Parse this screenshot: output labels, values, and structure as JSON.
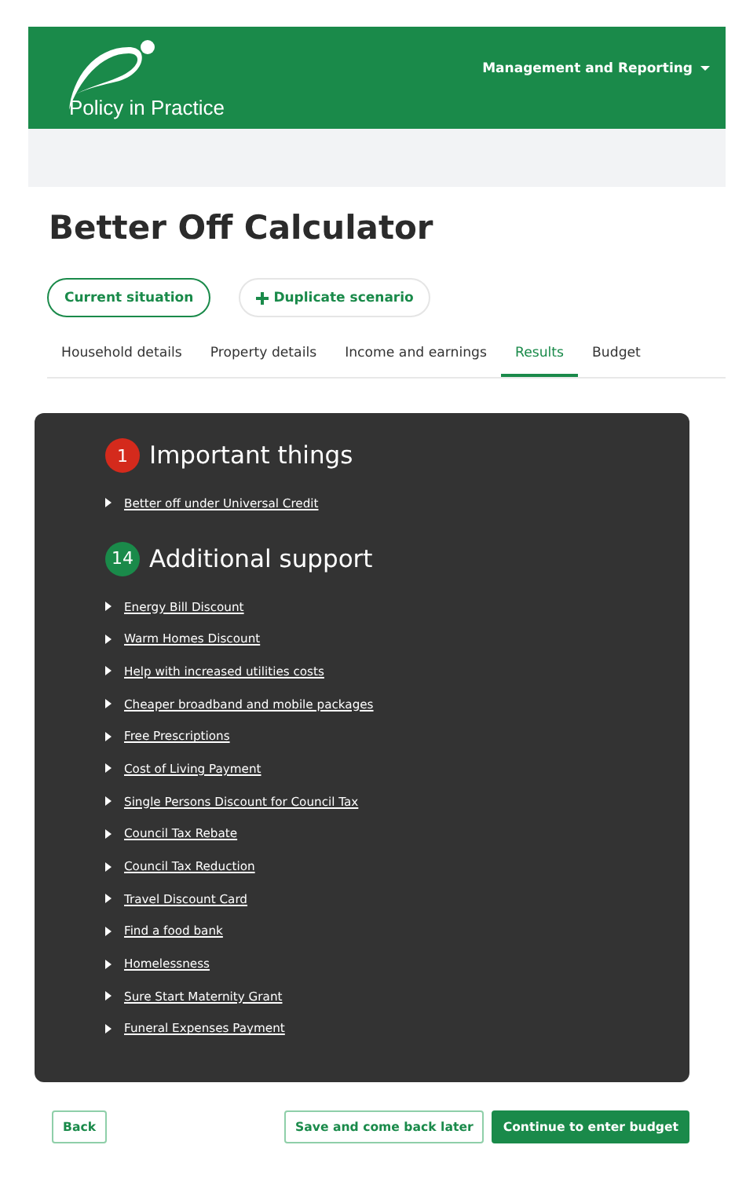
{
  "header": {
    "logo": "Policy in Practice",
    "menu": "Management and Reporting"
  },
  "title": "Better Off Calculator",
  "scenario_buttons": [
    {
      "label": "Current situation",
      "kind": "scenario"
    },
    {
      "label": "Duplicate scenario",
      "kind": "add"
    }
  ],
  "tabs": [
    {
      "label": "Household details",
      "selected": false
    },
    {
      "label": "Property details",
      "selected": false
    },
    {
      "label": "Income and earnings",
      "selected": false
    },
    {
      "label": "Results",
      "selected": true
    },
    {
      "label": "Budget",
      "selected": false
    }
  ],
  "sections": [
    {
      "count": "1",
      "color": "#d42a1c",
      "heading": "Important things",
      "items": [
        "Better off under Universal Credit"
      ]
    },
    {
      "count": "14",
      "color": "#1a8a4a",
      "heading": "Additional support",
      "items": [
        "Energy Bill Discount",
        "Warm Homes Discount",
        "Help with increased utilities costs",
        "Cheaper broadband and mobile packages",
        "Free Prescriptions",
        "Cost of Living Payment",
        "Single Persons Discount for Council Tax",
        "Council Tax Rebate",
        "Council Tax Reduction",
        "Travel Discount Card",
        "Find a food bank",
        "Homelessness",
        "Sure Start Maternity Grant",
        "Funeral Expenses Payment"
      ]
    }
  ],
  "footer_buttons": [
    {
      "label": "Back",
      "kind": "outline"
    },
    {
      "label": "Save and come back later",
      "kind": "outline"
    },
    {
      "label": "Continue to enter budget",
      "kind": "primary"
    }
  ]
}
